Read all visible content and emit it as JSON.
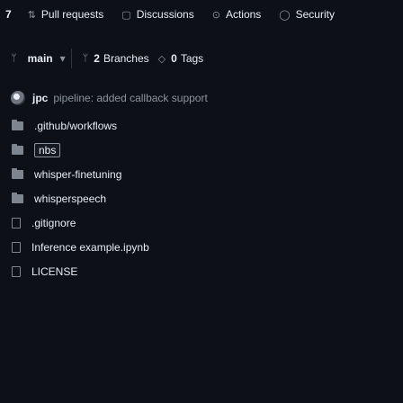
{
  "tabs": {
    "code_count": "7",
    "pull_requests": "Pull requests",
    "discussions": "Discussions",
    "actions": "Actions",
    "security": "Security"
  },
  "branch": {
    "name": "main",
    "dropdown_caret": "▾",
    "branches_count": "2",
    "branches_label": "Branches",
    "tags_count": "0",
    "tags_label": "Tags"
  },
  "commit": {
    "author": "jpc",
    "message": "pipeline: added callback support"
  },
  "files": [
    {
      "type": "folder",
      "name": ".github/workflows"
    },
    {
      "type": "folder",
      "name": "nbs"
    },
    {
      "type": "folder",
      "name": "whisper-finetuning"
    },
    {
      "type": "folder",
      "name": "whisperspeech"
    },
    {
      "type": "file",
      "name": ".gitignore"
    },
    {
      "type": "file",
      "name": "Inference example.ipynb"
    },
    {
      "type": "file",
      "name": "LICENSE"
    }
  ]
}
